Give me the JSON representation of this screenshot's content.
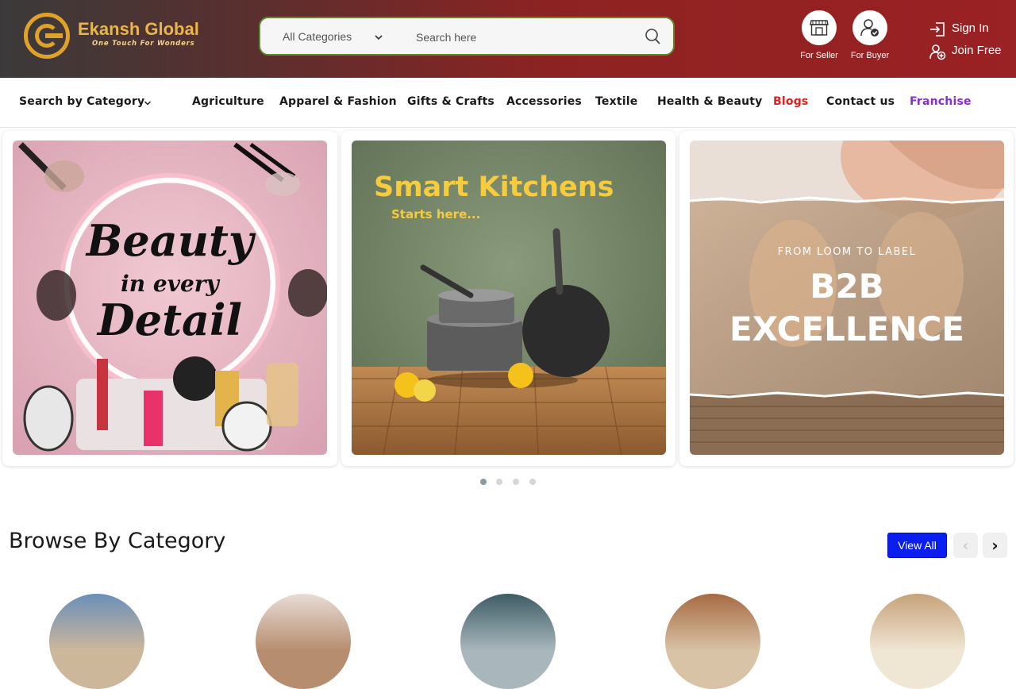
{
  "brand": {
    "name": "Ekansh Global",
    "tagline": "One Touch For Wonders"
  },
  "search": {
    "category_label": "All Categories",
    "placeholder": "Search here"
  },
  "roles": [
    {
      "label": "For Seller"
    },
    {
      "label": "For Buyer"
    }
  ],
  "auth": {
    "sign_in": "Sign In",
    "join_free": "Join Free"
  },
  "nav": {
    "dropdown": "Search by Category",
    "items": [
      "Agriculture",
      "Apparel & Fashion",
      "Gifts & Crafts",
      "Accessories",
      "Textile",
      "Health & Beauty",
      "Blogs",
      "Contact us",
      "Franchise"
    ]
  },
  "banners": {
    "beauty": {
      "line1": "Beauty",
      "line2": "in every",
      "line3": "Detail"
    },
    "kitchen": {
      "title": "Smart Kitchens",
      "subtitle": "Starts here..."
    },
    "b2b": {
      "kicker": "FROM LOOM TO LABEL",
      "line1": "B2B",
      "line2": "EXCELLENCE"
    }
  },
  "carousel": {
    "active_index": 0,
    "count": 4
  },
  "browse": {
    "title": "Browse By Category",
    "view_all": "View All",
    "prev": "‹",
    "next": "›"
  },
  "colors": {
    "nav_blogs": "#e0201f",
    "nav_franchise": "#8a2bd6",
    "view_all_bg": "#0a1ef0",
    "brand_gold": "#e0a329"
  }
}
